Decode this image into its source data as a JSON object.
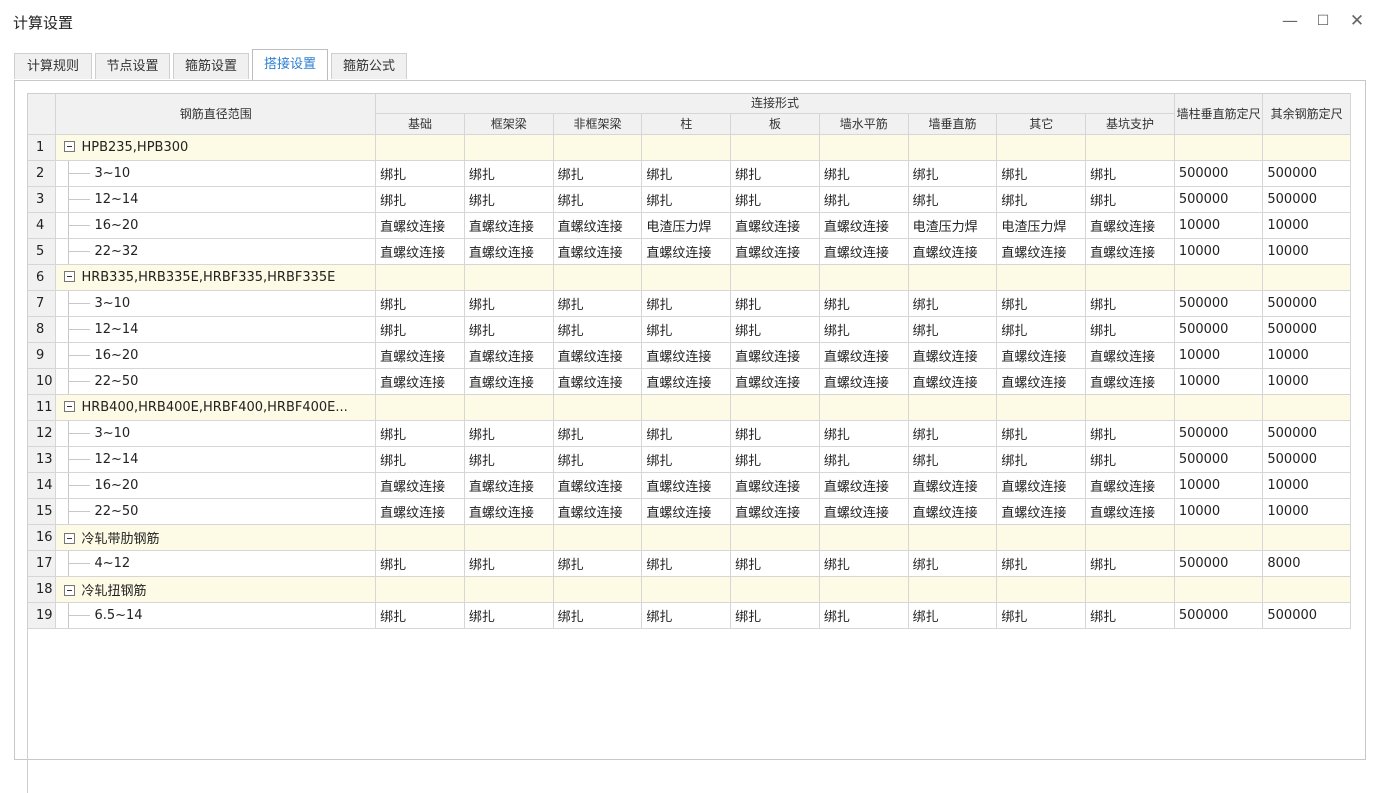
{
  "window": {
    "title": "计算设置",
    "min": "—",
    "max": "☐",
    "close": "✕"
  },
  "tabs": [
    {
      "label": "计算规则",
      "active": false
    },
    {
      "label": "节点设置",
      "active": false
    },
    {
      "label": "箍筋设置",
      "active": false
    },
    {
      "label": "搭接设置",
      "active": true
    },
    {
      "label": "箍筋公式",
      "active": false
    }
  ],
  "table": {
    "range_header": "钢筋直径范围",
    "connection_header": "连接形式",
    "wall_header": "墙柱垂直筋定尺",
    "other_header": "其余钢筋定尺",
    "columns": [
      "基础",
      "框架梁",
      "非框架梁",
      "柱",
      "板",
      "墙水平筋",
      "墙垂直筋",
      "其它",
      "基坑支护"
    ],
    "rows": [
      {
        "num": "1",
        "group": true,
        "name": "HPB235,HPB300",
        "cells": []
      },
      {
        "num": "2",
        "group": false,
        "name": "3~10",
        "cells": [
          "绑扎",
          "绑扎",
          "绑扎",
          "绑扎",
          "绑扎",
          "绑扎",
          "绑扎",
          "绑扎",
          "绑扎",
          "500000",
          "500000"
        ]
      },
      {
        "num": "3",
        "group": false,
        "name": "12~14",
        "cells": [
          "绑扎",
          "绑扎",
          "绑扎",
          "绑扎",
          "绑扎",
          "绑扎",
          "绑扎",
          "绑扎",
          "绑扎",
          "500000",
          "500000"
        ]
      },
      {
        "num": "4",
        "group": false,
        "name": "16~20",
        "cells": [
          "直螺纹连接",
          "直螺纹连接",
          "直螺纹连接",
          "电渣压力焊",
          "直螺纹连接",
          "直螺纹连接",
          "电渣压力焊",
          "电渣压力焊",
          "直螺纹连接",
          "10000",
          "10000"
        ]
      },
      {
        "num": "5",
        "group": false,
        "name": "22~32",
        "cells": [
          "直螺纹连接",
          "直螺纹连接",
          "直螺纹连接",
          "直螺纹连接",
          "直螺纹连接",
          "直螺纹连接",
          "直螺纹连接",
          "直螺纹连接",
          "直螺纹连接",
          "10000",
          "10000"
        ]
      },
      {
        "num": "6",
        "group": true,
        "name": "HRB335,HRB335E,HRBF335,HRBF335E",
        "cells": []
      },
      {
        "num": "7",
        "group": false,
        "name": "3~10",
        "cells": [
          "绑扎",
          "绑扎",
          "绑扎",
          "绑扎",
          "绑扎",
          "绑扎",
          "绑扎",
          "绑扎",
          "绑扎",
          "500000",
          "500000"
        ]
      },
      {
        "num": "8",
        "group": false,
        "name": "12~14",
        "cells": [
          "绑扎",
          "绑扎",
          "绑扎",
          "绑扎",
          "绑扎",
          "绑扎",
          "绑扎",
          "绑扎",
          "绑扎",
          "500000",
          "500000"
        ]
      },
      {
        "num": "9",
        "group": false,
        "name": "16~20",
        "cells": [
          "直螺纹连接",
          "直螺纹连接",
          "直螺纹连接",
          "直螺纹连接",
          "直螺纹连接",
          "直螺纹连接",
          "直螺纹连接",
          "直螺纹连接",
          "直螺纹连接",
          "10000",
          "10000"
        ]
      },
      {
        "num": "10",
        "group": false,
        "name": "22~50",
        "cells": [
          "直螺纹连接",
          "直螺纹连接",
          "直螺纹连接",
          "直螺纹连接",
          "直螺纹连接",
          "直螺纹连接",
          "直螺纹连接",
          "直螺纹连接",
          "直螺纹连接",
          "10000",
          "10000"
        ]
      },
      {
        "num": "11",
        "group": true,
        "name": "HRB400,HRB400E,HRBF400,HRBF400E...",
        "cells": []
      },
      {
        "num": "12",
        "group": false,
        "name": "3~10",
        "cells": [
          "绑扎",
          "绑扎",
          "绑扎",
          "绑扎",
          "绑扎",
          "绑扎",
          "绑扎",
          "绑扎",
          "绑扎",
          "500000",
          "500000"
        ]
      },
      {
        "num": "13",
        "group": false,
        "name": "12~14",
        "cells": [
          "绑扎",
          "绑扎",
          "绑扎",
          "绑扎",
          "绑扎",
          "绑扎",
          "绑扎",
          "绑扎",
          "绑扎",
          "500000",
          "500000"
        ]
      },
      {
        "num": "14",
        "group": false,
        "name": "16~20",
        "cells": [
          "直螺纹连接",
          "直螺纹连接",
          "直螺纹连接",
          "直螺纹连接",
          "直螺纹连接",
          "直螺纹连接",
          "直螺纹连接",
          "直螺纹连接",
          "直螺纹连接",
          "10000",
          "10000"
        ]
      },
      {
        "num": "15",
        "group": false,
        "name": "22~50",
        "cells": [
          "直螺纹连接",
          "直螺纹连接",
          "直螺纹连接",
          "直螺纹连接",
          "直螺纹连接",
          "直螺纹连接",
          "直螺纹连接",
          "直螺纹连接",
          "直螺纹连接",
          "10000",
          "10000"
        ]
      },
      {
        "num": "16",
        "group": true,
        "name": "冷轧带肋钢筋",
        "cells": []
      },
      {
        "num": "17",
        "group": false,
        "name": "4~12",
        "cells": [
          "绑扎",
          "绑扎",
          "绑扎",
          "绑扎",
          "绑扎",
          "绑扎",
          "绑扎",
          "绑扎",
          "绑扎",
          "500000",
          "8000"
        ]
      },
      {
        "num": "18",
        "group": true,
        "name": "冷轧扭钢筋",
        "cells": []
      },
      {
        "num": "19",
        "group": false,
        "name": "6.5~14",
        "cells": [
          "绑扎",
          "绑扎",
          "绑扎",
          "绑扎",
          "绑扎",
          "绑扎",
          "绑扎",
          "绑扎",
          "绑扎",
          "500000",
          "500000"
        ]
      }
    ]
  }
}
